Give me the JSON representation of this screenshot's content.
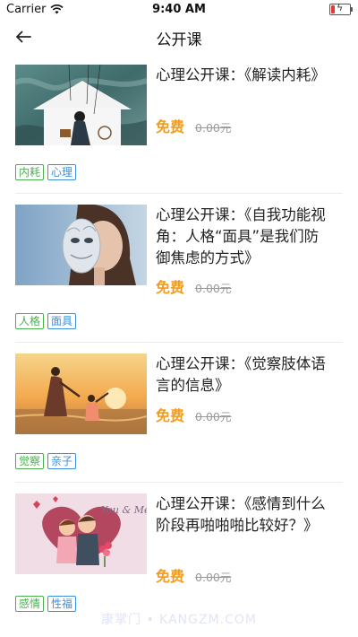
{
  "status_bar": {
    "carrier": "Carrier",
    "time": "9:40 AM"
  },
  "nav": {
    "title": "公开课"
  },
  "courses": [
    {
      "title": "心理公开课：《解读内耗》",
      "price": "免费",
      "original_price": "0.00元",
      "tags": [
        {
          "text": "内耗",
          "color": "green"
        },
        {
          "text": "心理",
          "color": "blue"
        }
      ]
    },
    {
      "title": "心理公开课：《自我功能视角：人格“面具”是我们防御焦虑的方式》",
      "price": "免费",
      "original_price": "0.00元",
      "tags": [
        {
          "text": "人格",
          "color": "green"
        },
        {
          "text": "面具",
          "color": "blue"
        }
      ]
    },
    {
      "title": "心理公开课：《觉察肢体语言的信息》",
      "price": "免费",
      "original_price": "0.00元",
      "tags": [
        {
          "text": "觉察",
          "color": "green"
        },
        {
          "text": "亲子",
          "color": "blue"
        }
      ]
    },
    {
      "title": "心理公开课：《感情到什么阶段再啪啪啪比较好？》",
      "price": "免费",
      "original_price": "0.00元",
      "tags": [
        {
          "text": "感情",
          "color": "green"
        },
        {
          "text": "性福",
          "color": "blue"
        }
      ]
    }
  ],
  "thumbnail_texts": {
    "card4": "You & Me"
  },
  "watermark": "康掌门 • KANGZM.COM",
  "colors": {
    "free_price": "#f39c1b",
    "tag_green": "#4caf50",
    "tag_blue": "#3d8fdd"
  }
}
